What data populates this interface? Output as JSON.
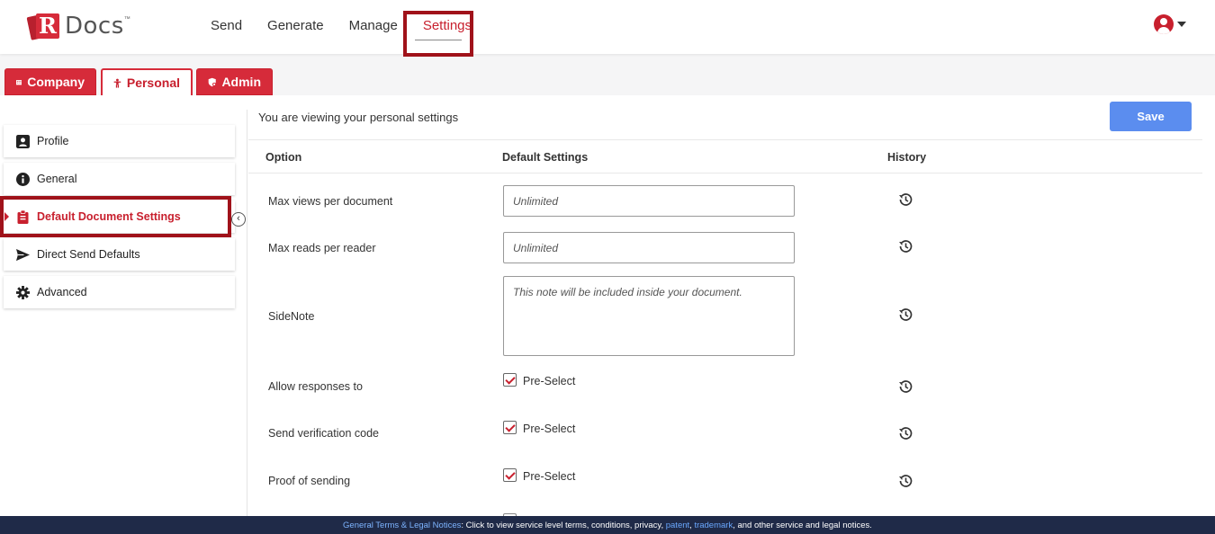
{
  "app": {
    "logo_text": "Docs",
    "logo_letter": "R",
    "logo_tm": "™"
  },
  "nav": {
    "items": [
      {
        "label": "Send"
      },
      {
        "label": "Generate"
      },
      {
        "label": "Manage"
      },
      {
        "label": "Settings",
        "active": true
      }
    ]
  },
  "category_tabs": [
    {
      "label": "Company",
      "icon": "building-icon"
    },
    {
      "label": "Personal",
      "icon": "person-icon",
      "selected": true
    },
    {
      "label": "Admin",
      "icon": "shield-icon"
    }
  ],
  "sidebar": {
    "items": [
      {
        "label": "Profile",
        "icon": "id-card-icon"
      },
      {
        "label": "General",
        "icon": "info-icon"
      },
      {
        "label": "Default Document Settings",
        "icon": "clipboard-icon",
        "active": true
      },
      {
        "label": "Direct Send Defaults",
        "icon": "paper-plane-icon"
      },
      {
        "label": "Advanced",
        "icon": "gear-icon"
      }
    ]
  },
  "main": {
    "viewing_text": "You are viewing your personal settings",
    "save_label": "Save",
    "columns": {
      "option": "Option",
      "default": "Default Settings",
      "history": "History"
    },
    "rows": [
      {
        "label": "Max views per document",
        "type": "text",
        "placeholder": "Unlimited"
      },
      {
        "label": "Max reads per reader",
        "type": "text",
        "placeholder": "Unlimited"
      },
      {
        "label": "SideNote",
        "type": "textarea",
        "placeholder": "This note will be included inside your document."
      },
      {
        "label": "Allow responses to",
        "type": "checkbox",
        "check_label": "Pre-Select",
        "checked": true
      },
      {
        "label": "Send verification code",
        "type": "checkbox",
        "check_label": "Pre-Select",
        "checked": true
      },
      {
        "label": "Proof of sending",
        "type": "checkbox",
        "check_label": "Pre-Select",
        "checked": true
      }
    ]
  },
  "footer": {
    "link_text": "General Terms & Legal Notices",
    "text1": ": Click to view service level terms, conditions, privacy, ",
    "patent": "patent",
    "sep": ", ",
    "trademark": "trademark",
    "text2": ", and other service and legal notices."
  },
  "colors": {
    "brand_red": "#d62b3a",
    "highlight_border": "#a0121a",
    "save_blue": "#5b8def",
    "footer_bg": "#1f2a48"
  }
}
